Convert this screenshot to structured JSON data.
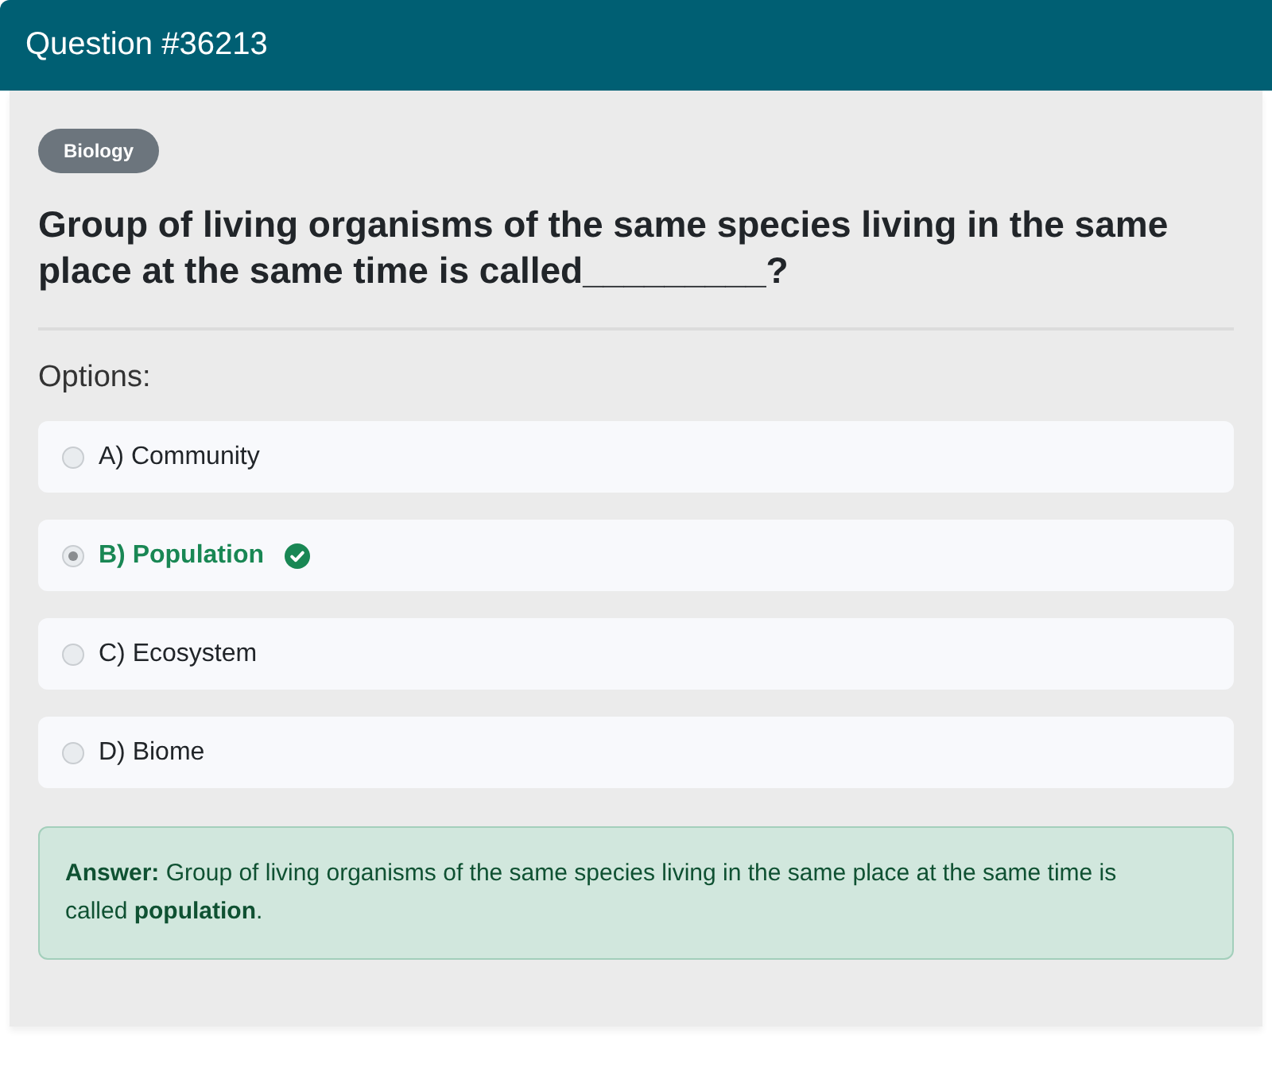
{
  "header": {
    "title": "Question #36213"
  },
  "category": {
    "label": "Biology"
  },
  "question": {
    "text": "Group of living organisms of the same species living in the same place at the same time is called_________?"
  },
  "options_label": "Options:",
  "options": [
    {
      "label": "A) Community",
      "selected": false,
      "correct": false
    },
    {
      "label": "B) Population",
      "selected": true,
      "correct": true
    },
    {
      "label": "C) Ecosystem",
      "selected": false,
      "correct": false
    },
    {
      "label": "D) Biome",
      "selected": false,
      "correct": false
    }
  ],
  "answer": {
    "text": "**Answer:** Group of living organisms of the same species living in the same place at the same time is called **population**."
  }
}
